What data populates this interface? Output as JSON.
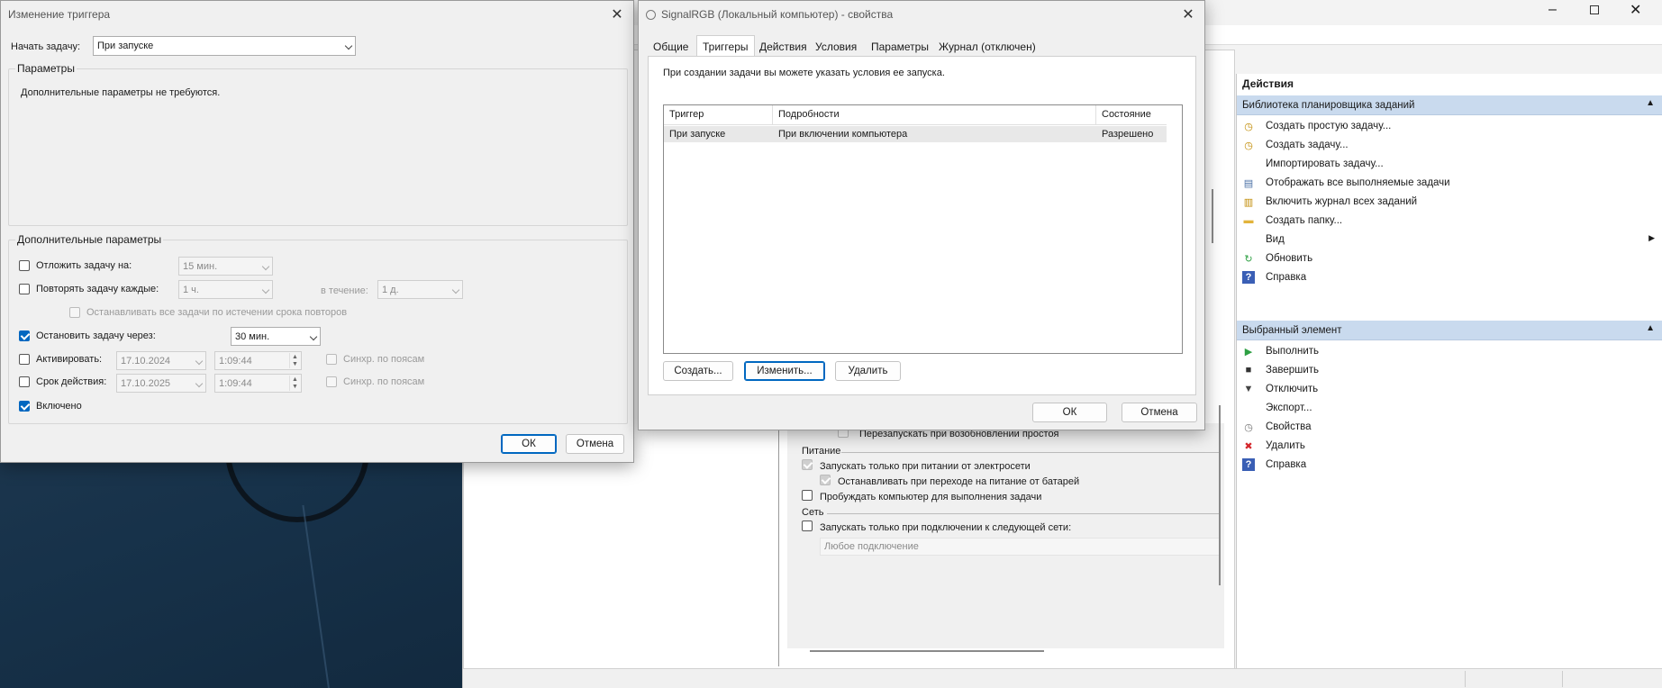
{
  "trigger_dialog": {
    "title": "Изменение триггера",
    "start_task_label": "Начать задачу:",
    "start_task_value": "При запуске",
    "params_group_title": "Параметры",
    "params_text": "Дополнительные параметры не требуются.",
    "advanced_group_title": "Дополнительные параметры",
    "delay_label": "Отложить задачу на:",
    "delay_value": "15 мин.",
    "repeat_label": "Повторять задачу каждые:",
    "repeat_value": "1 ч.",
    "duration_label": "в течение:",
    "duration_value": "1 д.",
    "stop_all_label": "Останавливать все задачи по истечении срока повторов",
    "stop_after_label": "Остановить задачу через:",
    "stop_after_value": "30 мин.",
    "activate_label": "Активировать:",
    "activate_date": "17.10.2024",
    "activate_time": "1:09:44",
    "expire_label": "Срок действия:",
    "expire_date": "17.10.2025",
    "expire_time": "1:09:44",
    "sync_label_1": "Синхр. по поясам",
    "sync_label_2": "Синхр. по поясам",
    "enabled_label": "Включено",
    "ok": "ОК",
    "cancel": "Отмена"
  },
  "props_dialog": {
    "title": "SignalRGB (Локальный компьютер) - свойства",
    "tabs": [
      "Общие",
      "Триггеры",
      "Действия",
      "Условия",
      "Параметры",
      "Журнал (отключен)"
    ],
    "intro": "При создании задачи вы можете указать условия ее запуска.",
    "columns": [
      "Триггер",
      "Подробности",
      "Состояние"
    ],
    "rows": [
      {
        "trigger": "При запуске",
        "details": "При включении компьютера",
        "state": "Разрешено"
      }
    ],
    "create": "Создать...",
    "edit": "Изменить...",
    "delete": "Удалить",
    "ok": "ОК",
    "cancel": "Отмена"
  },
  "conditions_peek": {
    "restart_idle": "Перезапускать при возобновлении простоя",
    "power_title": "Питание",
    "ac_only": "Запускать только при питании от электросети",
    "stop_battery": "Останавливать при переходе на питание от батарей",
    "wake": "Пробуждать компьютер для выполнения задачи",
    "network_title": "Сеть",
    "network_only": "Запускать только при подключении к следующей сети:",
    "network_value": "Любое подключение"
  },
  "actions_panel": {
    "title": "Действия",
    "library_header": "Библиотека планировщика заданий",
    "library_items": [
      {
        "label": "Создать простую задачу...",
        "icon": "create-basic-task-icon"
      },
      {
        "label": "Создать задачу...",
        "icon": "create-task-icon"
      },
      {
        "label": "Импортировать задачу...",
        "icon": ""
      },
      {
        "label": "Отображать все выполняемые задачи",
        "icon": "running-tasks-icon"
      },
      {
        "label": "Включить журнал всех заданий",
        "icon": "history-icon"
      },
      {
        "label": "Создать папку...",
        "icon": "folder-icon"
      },
      {
        "label": "Вид",
        "icon": ""
      },
      {
        "label": "Обновить",
        "icon": "refresh-icon"
      },
      {
        "label": "Справка",
        "icon": "help-icon"
      }
    ],
    "selected_header": "Выбранный элемент",
    "selected_items": [
      {
        "label": "Выполнить",
        "icon": "run-icon"
      },
      {
        "label": "Завершить",
        "icon": "end-icon"
      },
      {
        "label": "Отключить",
        "icon": "disable-icon"
      },
      {
        "label": "Экспорт...",
        "icon": ""
      },
      {
        "label": "Свойства",
        "icon": "properties-icon"
      },
      {
        "label": "Удалить",
        "icon": "delete-icon"
      },
      {
        "label": "Справка",
        "icon": "help-icon"
      }
    ]
  },
  "colors": {
    "accent": "#0067c0",
    "header_blue": "#c9daee",
    "delete_red": "#d4262b",
    "run_green": "#2ea043"
  }
}
